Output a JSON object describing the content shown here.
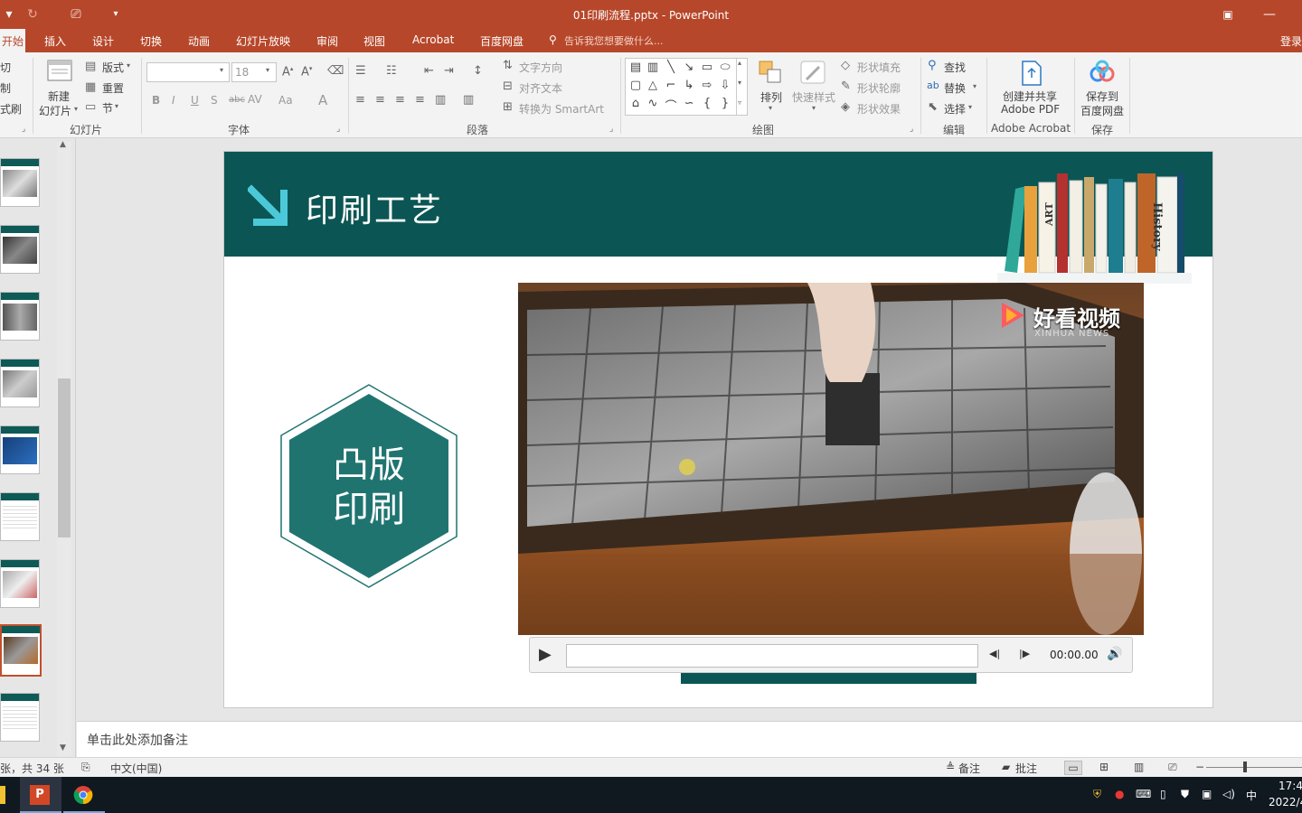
{
  "window": {
    "title": "01印刷流程.pptx - PowerPoint"
  },
  "tabs": [
    "开始",
    "插入",
    "设计",
    "切换",
    "动画",
    "幻灯片放映",
    "审阅",
    "视图",
    "Acrobat",
    "百度网盘"
  ],
  "tell_me": "告诉我您想要做什么...",
  "login": "登录",
  "ribbon": {
    "clipboard": {
      "cut": "切",
      "copy": "制",
      "format_painter": "式刷"
    },
    "slides": {
      "new_slide_line1": "新建",
      "new_slide_line2": "幻灯片",
      "layout": "版式",
      "reset": "重置",
      "section": "节",
      "label": "幻灯片"
    },
    "font": {
      "size": "18",
      "label": "字体",
      "bold": "B",
      "italic": "I",
      "underline": "U",
      "shadow": "S",
      "strike": "abc",
      "spacing": "AV",
      "case": "Aa",
      "color": "A"
    },
    "paragraph": {
      "text_direction": "文字方向",
      "align_text": "对齐文本",
      "smartart": "转换为 SmartArt",
      "label": "段落"
    },
    "drawing": {
      "arrange": "排列",
      "quick_styles": "快速样式",
      "shape_fill": "形状填充",
      "shape_outline": "形状轮廓",
      "shape_effects": "形状效果",
      "label": "绘图"
    },
    "editing": {
      "find": "查找",
      "replace": "替换",
      "select": "选择",
      "label": "编辑"
    },
    "acrobat": {
      "line1": "创建并共享",
      "line2": "Adobe PDF",
      "label": "Adobe Acrobat"
    },
    "save": {
      "line1": "保存到",
      "line2": "百度网盘",
      "label": "保存"
    }
  },
  "slide": {
    "title": "印刷工艺",
    "hexagon_line1": "凸版",
    "hexagon_line2": "印刷",
    "book_labels": [
      "ART",
      "History"
    ],
    "video_watermark": "好看视频",
    "video_watermark_sub": "XINHUA NEWS",
    "timecode": "00:00.00"
  },
  "notes_placeholder": "单击此处添加备注",
  "status": {
    "slide_count": "张，共 34 张",
    "language": "中文(中国)",
    "notes": "备注",
    "comments": "批注"
  },
  "taskbar": {
    "ime": "中",
    "time": "17:4",
    "date": "2022/4"
  },
  "colors": {
    "ppt_accent": "#b7472a",
    "slide_teal": "#0b5654",
    "hex_fill": "#1f7470"
  }
}
